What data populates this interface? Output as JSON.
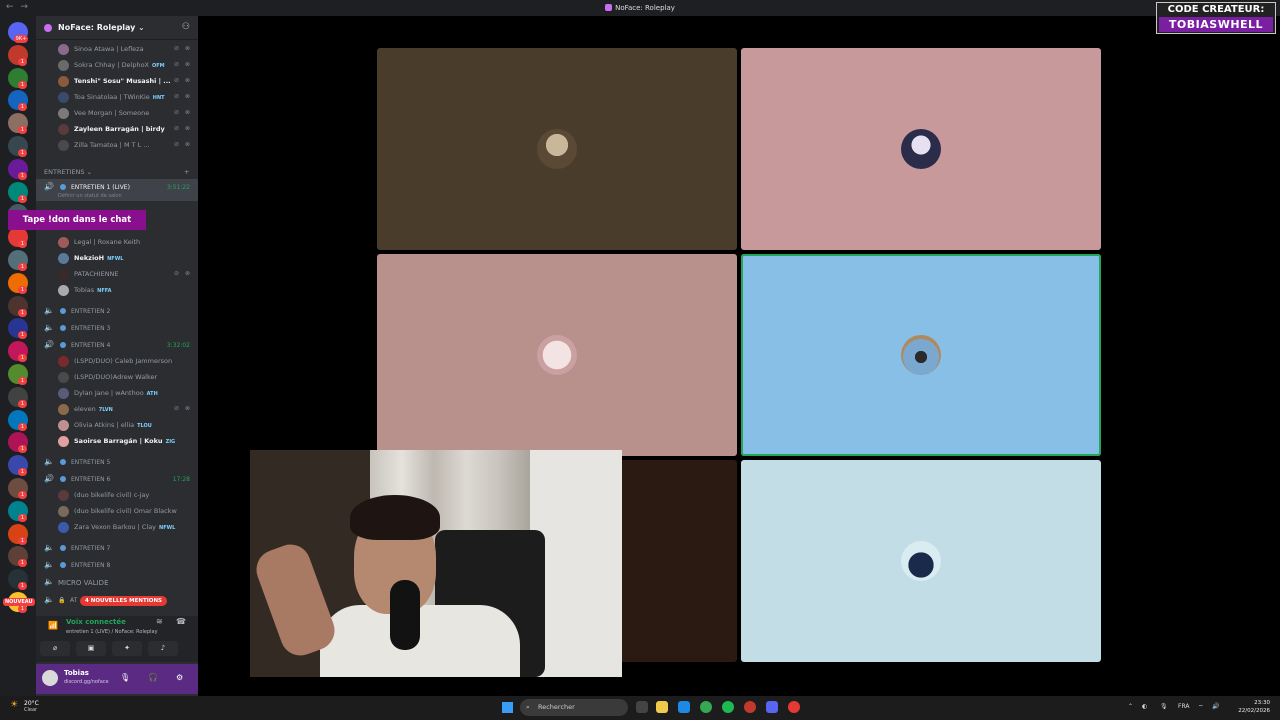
{
  "window": {
    "title": "NoFace: Roleplay"
  },
  "creator_banner": {
    "line1": "CODE CREATEUR:",
    "line2": "TOBIASWHELL"
  },
  "rail": {
    "badges": [
      "9K+",
      "1",
      "1",
      "1",
      "1",
      "1",
      "1",
      "1",
      "1",
      "1",
      "1",
      "1",
      "1",
      "1",
      "1",
      "1",
      "1",
      "1",
      "1",
      "1",
      "1",
      "1",
      "1",
      "1",
      "1",
      "1"
    ],
    "nouveau": "NOUVEAU"
  },
  "server": {
    "name": "NoFace: Roleplay"
  },
  "members_top": [
    {
      "name": "Sinoa Atawa | Lefleza",
      "bold": false
    },
    {
      "name": "Sokra Chhay | DelphoX",
      "tag": "OFM",
      "bold": false
    },
    {
      "name": "Tenshi\" Sosu\" Musashi | ...",
      "bold": true
    },
    {
      "name": "Toa Sinatolaa | TWinKie",
      "tag": "HNT",
      "bold": false
    },
    {
      "name": "Vee Morgan | Someone",
      "bold": false
    },
    {
      "name": "Zayleen Barragán | birdy",
      "bold": true
    },
    {
      "name": "Zilla Tamatoa | M T L ...",
      "bold": false
    }
  ],
  "category": {
    "name": "ENTRETIENS"
  },
  "channel1": {
    "name": "ENTRETIEN 1 (LIVE)",
    "time": "3:51:22",
    "status": "Définir un statut de salon"
  },
  "overlay_text": "Tape !don dans le chat",
  "members_ch1": [
    {
      "name": "Legal | Roxane Keith",
      "bold": false
    },
    {
      "name": "NekzioH",
      "tag": "NFWL",
      "bold": true
    },
    {
      "name": "PATACHIENNE",
      "bold": false
    },
    {
      "name": "Tobias",
      "tag": "NFFA",
      "bold": false
    }
  ],
  "channel2": {
    "name": "ENTRETIEN 2"
  },
  "channel3": {
    "name": "ENTRETIEN 3"
  },
  "channel4": {
    "name": "ENTRETIEN 4",
    "time": "3:32:02"
  },
  "members_ch4": [
    {
      "name": "(LSPD/DUO) Caleb Jammerson",
      "bold": false
    },
    {
      "name": "(LSPD/DUO)Adrew Walker",
      "bold": false
    },
    {
      "name": "Dylan Jane | wAnthoo",
      "tag": "ATH",
      "bold": false
    },
    {
      "name": "eleven",
      "tag": "7LVN",
      "bold": false
    },
    {
      "name": "Olivia Atkins | ellia",
      "tag": "TLOU",
      "bold": false
    },
    {
      "name": "Saoirse Barragán | Koku",
      "tag": "ZIG",
      "bold": true
    }
  ],
  "channel5": {
    "name": "ENTRETIEN 5"
  },
  "channel6": {
    "name": "ENTRETIEN 6",
    "time": "17:28"
  },
  "members_ch6": [
    {
      "name": "(duo bikelife civil) c-jay",
      "bold": false
    },
    {
      "name": "(duo bikelife civil) Omar Blackw",
      "bold": false
    },
    {
      "name": "Zara Vexon Barkou | Clay",
      "tag": "NFWL",
      "bold": false
    }
  ],
  "channel7": {
    "name": "ENTRETIEN 7"
  },
  "channel8": {
    "name": "ENTRETIEN 8"
  },
  "micro": {
    "name": "MICRO VALIDE"
  },
  "locked": {
    "name": "AT"
  },
  "mentions": "4 NOUVELLES MENTIONS",
  "voice": {
    "status": "Voix connectée",
    "location": "entretien 1 (LIVE) / NoFace: Roleplay"
  },
  "user": {
    "name": "Tobias",
    "status": "discord.gg/noface"
  },
  "taskbar": {
    "temp": "20°C",
    "weather": "Clear",
    "search_placeholder": "Rechercher",
    "lang": "FRA",
    "time": "23:30",
    "date": "22/02/2026"
  },
  "colors": {
    "tile1": "#4a3c2a",
    "tile2": "#c8999b",
    "tile3": "#b8918d",
    "tile4": "#87bfe6",
    "tile5": "#2a1a12",
    "tile6": "#c2dde6",
    "accent": "#23a55a"
  }
}
